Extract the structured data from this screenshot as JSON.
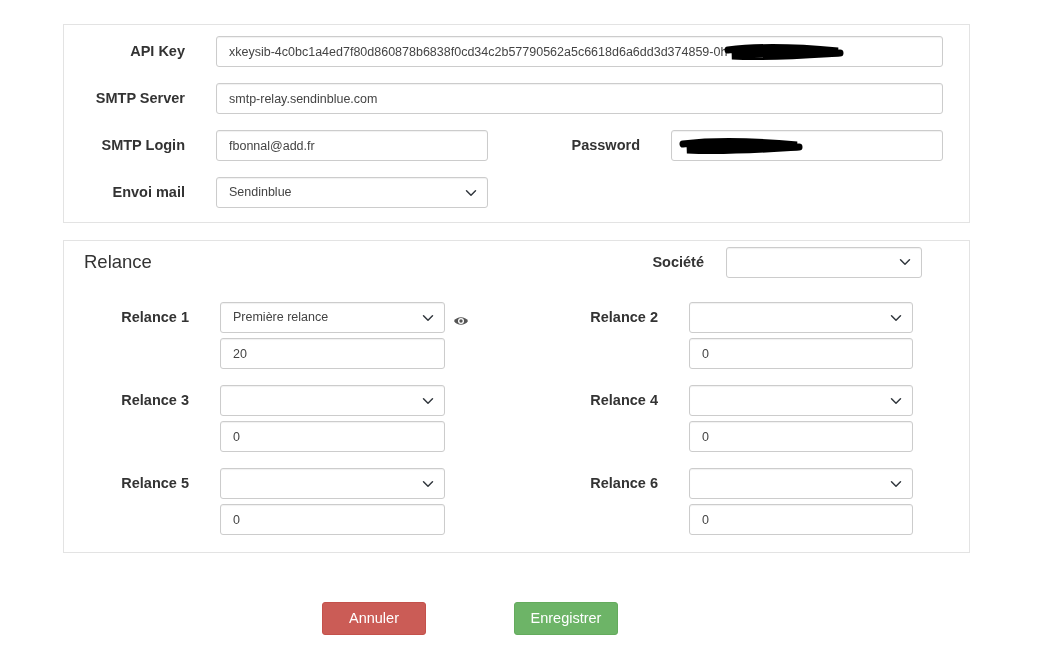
{
  "mail_settings": {
    "api_key": {
      "label": "API Key",
      "value": "xkeysib-4c0bc1a4ed7f80d860878b6838f0cd34c2b57790562a5c6618d6a6dd3d374859-0h",
      "redacted": true
    },
    "smtp_server": {
      "label": "SMTP Server",
      "value": "smtp-relay.sendinblue.com"
    },
    "smtp_login": {
      "label": "SMTP Login",
      "value": "fbonnal@add.fr"
    },
    "password": {
      "label": "Password",
      "redacted": true
    },
    "envoi_mail": {
      "label": "Envoi mail",
      "value": "Sendinblue"
    }
  },
  "relance": {
    "title": "Relance",
    "societe": {
      "label": "Société"
    },
    "items": [
      {
        "label": "Relance 1",
        "template": "Première relance",
        "days": "20",
        "preview": true
      },
      {
        "label": "Relance 2",
        "days": "0"
      },
      {
        "label": "Relance 3",
        "days": "0"
      },
      {
        "label": "Relance 4",
        "days": "0"
      },
      {
        "label": "Relance 5",
        "days": "0"
      },
      {
        "label": "Relance 6",
        "days": "0"
      }
    ]
  },
  "buttons": [
    {
      "label": "Annuler",
      "kind": "cancel"
    },
    {
      "label": "Enregistrer",
      "kind": "save"
    }
  ]
}
